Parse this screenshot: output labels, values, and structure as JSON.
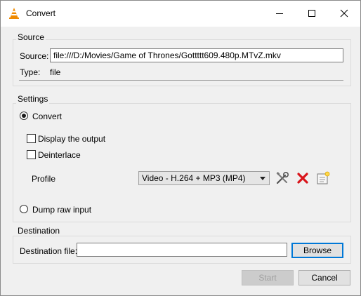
{
  "window": {
    "title": "Convert"
  },
  "source": {
    "group_title": "Source",
    "source_label": "Source:",
    "source_value": "file:///D:/Movies/Game of Thrones/Gottttt609.480p.MTvZ.mkv",
    "type_label": "Type:",
    "type_value": "file"
  },
  "settings": {
    "group_title": "Settings",
    "convert_label": "Convert",
    "convert_selected": true,
    "display_output_label": "Display the output",
    "display_output_checked": false,
    "deinterlace_label": "Deinterlace",
    "deinterlace_checked": false,
    "profile_label": "Profile",
    "profile_selected": "Video - H.264 + MP3 (MP4)",
    "profile_icons": [
      "edit-profile-icon",
      "delete-profile-icon",
      "new-profile-icon"
    ],
    "dump_raw_label": "Dump raw input",
    "dump_raw_selected": false
  },
  "destination": {
    "group_title": "Destination",
    "file_label": "Destination file:",
    "file_value": "",
    "browse_label": "Browse"
  },
  "footer": {
    "start_label": "Start",
    "start_enabled": false,
    "cancel_label": "Cancel"
  },
  "colors": {
    "accent": "#0078d7",
    "delete_red": "#d9141a",
    "vlc_orange": "#f08a00"
  }
}
